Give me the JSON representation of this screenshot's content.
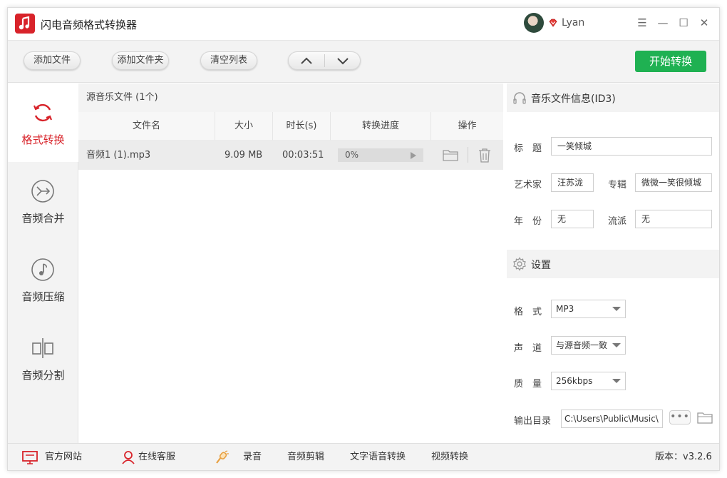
{
  "app": {
    "title": "闪电音频格式转换器",
    "user": "Lyan",
    "brand_color": "#d8232a",
    "accent_color": "#1fb152"
  },
  "window_controls": {
    "menu": "☰",
    "minimize": "—",
    "maximize": "☐",
    "close": "✕"
  },
  "toolbar": {
    "add_file": "添加文件",
    "add_folder": "添加文件夹",
    "clear_list": "清空列表",
    "start": "开始转换"
  },
  "sidebar": {
    "items": [
      {
        "label": "格式转换",
        "icon": "refresh-icon"
      },
      {
        "label": "音频合并",
        "icon": "merge-icon"
      },
      {
        "label": "音频压缩",
        "icon": "music-note-icon"
      },
      {
        "label": "音频分割",
        "icon": "split-icon"
      }
    ]
  },
  "filelist": {
    "header": "源音乐文件 (1个)",
    "columns": [
      "文件名",
      "大小",
      "时长(s)",
      "转换进度",
      "操作"
    ],
    "rows": [
      {
        "name": "音频1 (1).mp3",
        "size": "9.09 MB",
        "duration": "00:03:51",
        "progress": "0%",
        "progress_value": 0
      }
    ]
  },
  "id3": {
    "header": "音乐文件信息(ID3)",
    "title_label": "标　题",
    "title_value": "一笑倾城",
    "artist_label": "艺术家",
    "artist_value": "汪苏泷",
    "album_label": "专辑",
    "album_value": "微微一笑很倾城",
    "year_label": "年　份",
    "year_value": "无",
    "genre_label": "流派",
    "genre_value": "无"
  },
  "settings": {
    "header": "设置",
    "format_label": "格　式",
    "format_value": "MP3",
    "channel_label": "声　道",
    "channel_value": "与源音频一致",
    "quality_label": "质　量",
    "quality_value": "256kbps",
    "output_label": "输出目录",
    "output_value": "C:\\Users\\Public\\Music\\",
    "dots": "•••"
  },
  "footer": {
    "website": "官方网站",
    "support": "在线客服",
    "record": "录音",
    "audio_cut": "音频剪辑",
    "tts": "文字语音转换",
    "video_convert": "视频转换",
    "version": "版本：v3.2.6"
  }
}
